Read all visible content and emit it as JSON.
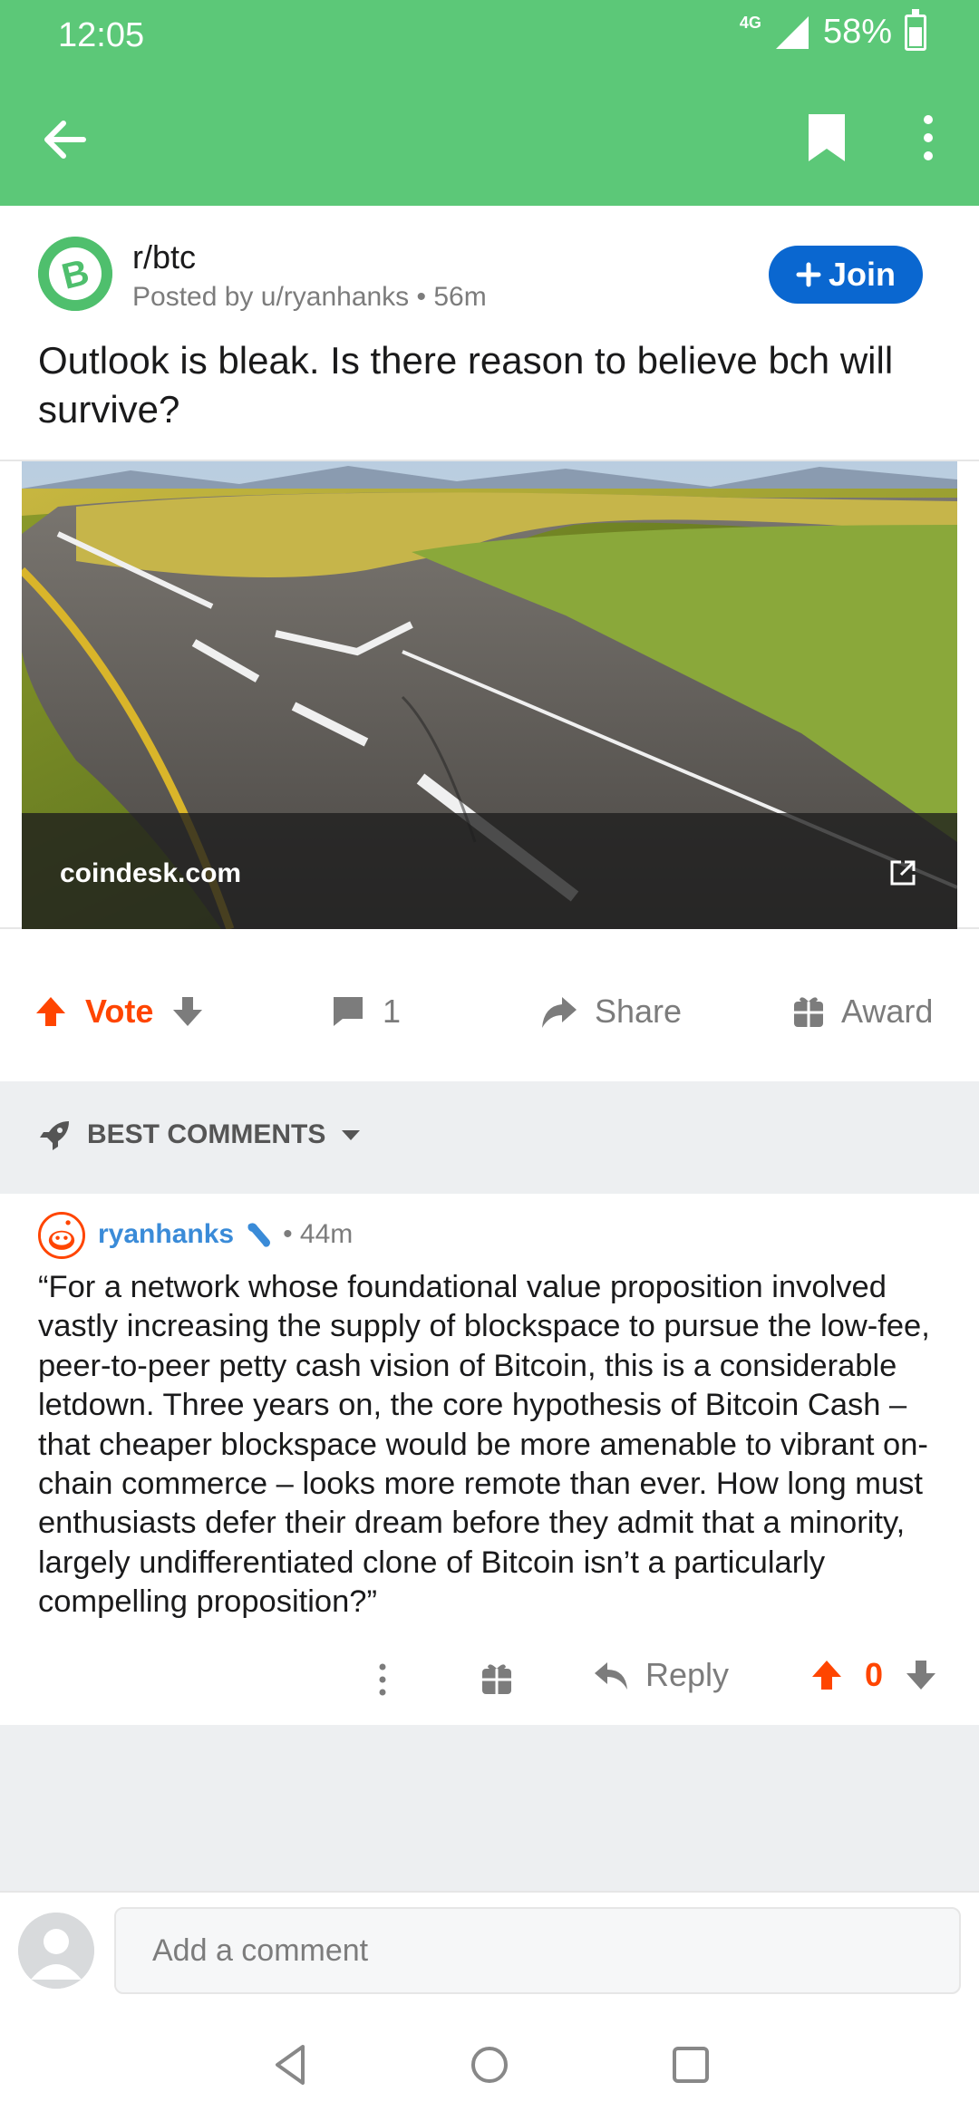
{
  "status_bar": {
    "time": "12:05",
    "network": "4G",
    "battery": "58%"
  },
  "post": {
    "subreddit": "r/btc",
    "posted_by": "Posted by u/ryanhanks • 56m",
    "join_label": "Join",
    "title": "Outlook is bleak. Is there reason to believe bch will survive?",
    "link_domain": "coindesk.com"
  },
  "actions": {
    "vote_label": "Vote",
    "comment_count": "1",
    "share_label": "Share",
    "award_label": "Award"
  },
  "sort": {
    "label": "BEST COMMENTS"
  },
  "comment": {
    "author": "ryanhanks",
    "age": "• 44m",
    "body": "“For a network whose foundational value proposition involved vastly increasing the supply of blockspace to pursue the low-fee, peer-to-peer petty cash vision of Bitcoin, this is a considerable letdown. Three years on, the core hypothesis of Bitcoin Cash – that cheaper blockspace would be more amenable to vibrant on-chain commerce – looks more remote than ever. How long must enthusiasts defer their dream before they admit that a minority, largely undifferentiated clone of Bitcoin isn’t a particularly compelling proposition?”",
    "reply_label": "Reply",
    "score": "0"
  },
  "composer": {
    "placeholder": "Add a comment"
  },
  "colors": {
    "header": "#5cc878",
    "join": "#0a67d0",
    "upvote": "#ff4500",
    "author": "#3a8bd8"
  }
}
